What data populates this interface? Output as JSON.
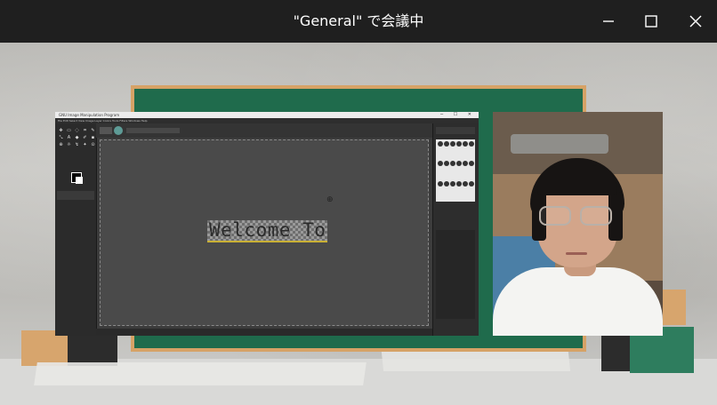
{
  "window": {
    "title": "\"General\" で会議中",
    "controls": {
      "minimize": "─",
      "maximize": "☐",
      "close": "✕"
    }
  },
  "shared_screen": {
    "app_title": "GNU Image Manipulation Program",
    "app_window_controls": "─ ☐ ✕",
    "menus": "File  Edit  Select  View  Image  Layer  Colors  Tools  Filters  Windows  Help",
    "canvas_text": "Welcome To"
  },
  "colors": {
    "titlebar": "#1f1f1f",
    "chalkboard": "#1f6b4c",
    "chalkboard_frame": "#d6a266",
    "app_background": "#3c3c3c"
  },
  "icons": [
    "minimize-icon",
    "maximize-icon",
    "close-icon",
    "tool-icons",
    "brush-presets"
  ]
}
